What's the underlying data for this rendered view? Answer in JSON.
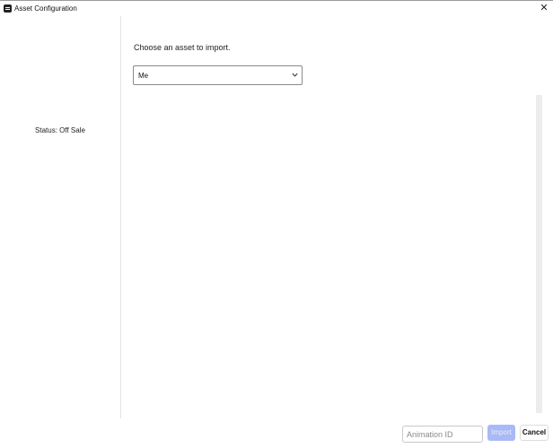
{
  "window": {
    "title": "Asset Configuration",
    "icons": {
      "app": "app-logo-icon",
      "close": "close-icon",
      "dropdown": "chevron-down-icon"
    }
  },
  "sidebar": {
    "status_text": "Status: Off Sale"
  },
  "main": {
    "prompt": "Choose an asset to import.",
    "owner_select": {
      "selected_value": "Me"
    }
  },
  "footer": {
    "animation_id_placeholder": "Animation ID",
    "import_label": "Import",
    "cancel_label": "Cancel"
  },
  "colors": {
    "accent_disabled": "#a9b9f5",
    "border": "#8a8a8a"
  }
}
